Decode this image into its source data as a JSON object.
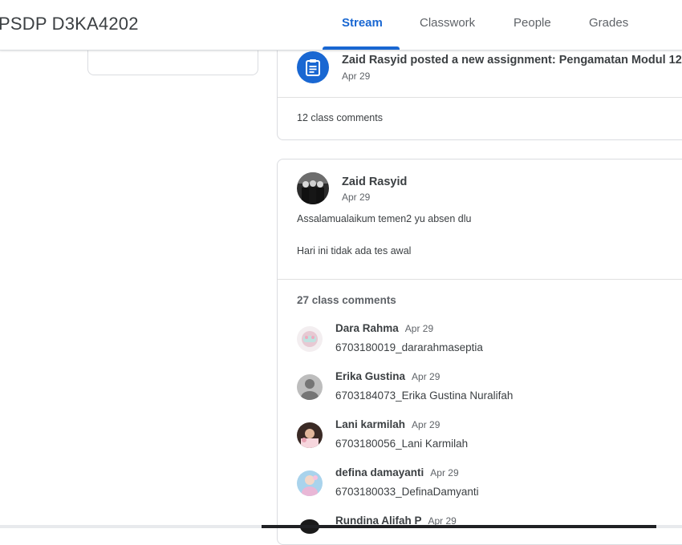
{
  "header": {
    "class_title": "PSDP D3KA4202",
    "tabs": [
      {
        "label": "Stream",
        "active": true
      },
      {
        "label": "Classwork",
        "active": false
      },
      {
        "label": "People",
        "active": false
      },
      {
        "label": "Grades",
        "active": false
      }
    ]
  },
  "colors": {
    "accent": "#1967d2",
    "text": "#3c4043",
    "muted": "#5f6368",
    "border": "#dadce0"
  },
  "assignment_post": {
    "icon": "assignment-icon",
    "title": "Zaid Rasyid posted a new assignment: Pengamatan Modul 12",
    "date": "Apr 29",
    "comments_link": "12 class comments"
  },
  "announcement": {
    "author": "Zaid Rasyid",
    "date": "Apr 29",
    "body": [
      "Assalamualaikum temen2 yu absen dlu",
      "Hari ini tidak ada tes awal"
    ],
    "comment_count": "27 class comments",
    "comments": [
      {
        "name": "Dara Rahma",
        "date": "Apr 29",
        "text": "6703180019_dararahmaseptia"
      },
      {
        "name": "Erika Gustina",
        "date": "Apr 29",
        "text": "6703184073_Erika Gustina Nuralifah"
      },
      {
        "name": "Lani karmilah",
        "date": "Apr 29",
        "text": "6703180056_Lani Karmilah"
      },
      {
        "name": "defina damayanti",
        "date": "Apr 29",
        "text": "6703180033_DefinaDamyanti"
      },
      {
        "name": "Rundina Alifah P",
        "date": "Apr 29",
        "text": ""
      }
    ]
  }
}
